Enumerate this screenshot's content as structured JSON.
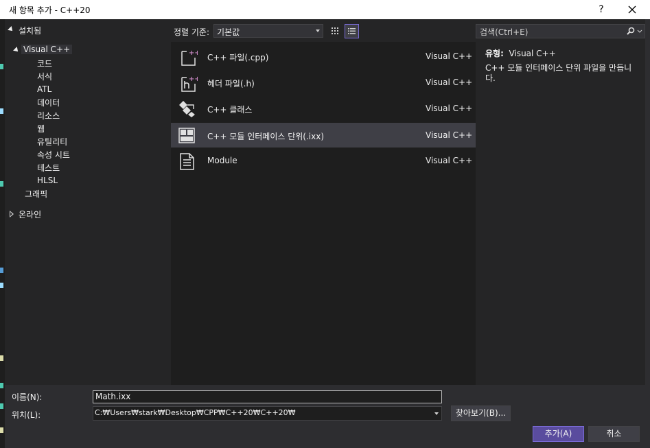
{
  "window": {
    "title": "새 항목 추가 - C++20",
    "help_label": "?",
    "close_label": "✕"
  },
  "tree": {
    "installed": "설치됨",
    "visual_cpp": "Visual C++",
    "children": [
      "코드",
      "서식",
      "ATL",
      "데이터",
      "리소스",
      "웹",
      "유틸리티",
      "속성 시트",
      "테스트",
      "HLSL"
    ],
    "graphics": "그래픽",
    "online": "온라인"
  },
  "sort": {
    "label": "정렬 기준:",
    "value": "기본값"
  },
  "templates": [
    {
      "name": "C++ 파일(.cpp)",
      "lang": "Visual C++",
      "icon": "cpp-file-icon"
    },
    {
      "name": "헤더 파일(.h)",
      "lang": "Visual C++",
      "icon": "header-file-icon"
    },
    {
      "name": "C++ 클래스",
      "lang": "Visual C++",
      "icon": "class-icon"
    },
    {
      "name": "C++ 모듈 인터페이스 단위(.ixx)",
      "lang": "Visual C++",
      "icon": "module-interface-icon"
    },
    {
      "name": "Module",
      "lang": "Visual C++",
      "icon": "module-file-icon"
    }
  ],
  "search": {
    "placeholder": "검색(Ctrl+E)"
  },
  "details": {
    "type_label": "유형:",
    "type_value": "Visual C++",
    "description": "C++ 모듈 인터페이스 단위 파일을 만듭니다."
  },
  "form": {
    "name_label": "이름(N):",
    "name_value": "Math.ixx",
    "location_label": "위치(L):",
    "location_value": "C:₩Users₩stark₩Desktop₩CPP₩C++20₩C++20₩",
    "browse_label": "찾아보기(B)...",
    "add_label": "추가(A)",
    "cancel_label": "취소"
  },
  "colors": {
    "accent": "#5a4c9e",
    "selection": "#3f3f46",
    "icon_purple": "#c586c0"
  }
}
